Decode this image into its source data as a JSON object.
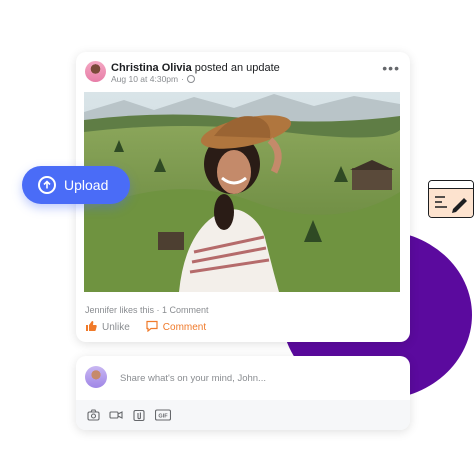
{
  "post": {
    "author_name": "Christina Olivia",
    "action_text": "posted an update",
    "timestamp": "Aug 10 at 4:30pm",
    "separator": "·",
    "privacy_icon": "globe-icon",
    "more_label": "•••",
    "likes_text": "Jennifer likes this · 1 Comment",
    "actions": [
      {
        "label": "Unlike",
        "icon": "thumbs-up-icon"
      },
      {
        "label": "Comment",
        "icon": "comment-icon"
      }
    ]
  },
  "upload_button": {
    "label": "Upload",
    "icon": "upload-arrow-icon"
  },
  "compose": {
    "placeholder": "Share what's on your mind, John...",
    "tools": [
      "camera-icon",
      "video-icon",
      "attachment-icon",
      "gif-icon"
    ],
    "gif_label": "GIF"
  },
  "colors": {
    "brand_blue": "#4a6cf7",
    "accent_orange": "#f07a2a",
    "purple": "#5b0a9e"
  }
}
